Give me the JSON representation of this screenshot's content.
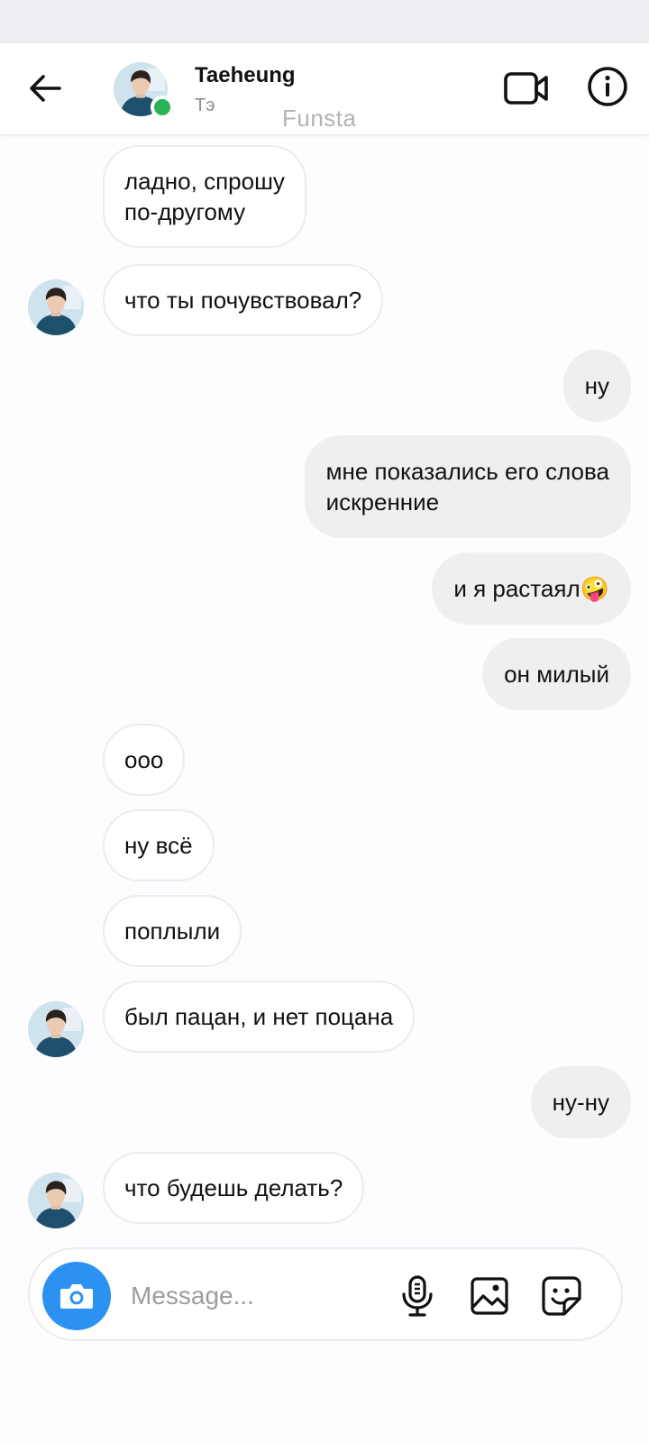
{
  "header": {
    "name": "Taeheung",
    "subtitle": "Тэ",
    "watermark": "Funsta"
  },
  "icons": {
    "back": "arrow-left-icon",
    "video": "video-camera-icon",
    "info": "info-icon",
    "camera": "camera-icon",
    "mic": "microphone-icon",
    "gallery": "image-icon",
    "sticker": "sticker-icon"
  },
  "colors": {
    "accent": "#2c92f2",
    "online": "#29b257",
    "incoming_bubble": "#ffffff",
    "outgoing_bubble": "#efeef1"
  },
  "messages": [
    {
      "from": "them",
      "text": "ладно, спрошу\nпо-другому",
      "avatar": false
    },
    {
      "from": "them",
      "text": "что ты почувствовал?",
      "avatar": true
    },
    {
      "from": "me",
      "text": "ну"
    },
    {
      "from": "me",
      "text": "мне показались его слова\nискренние"
    },
    {
      "from": "me",
      "text": "и я растаял🤪"
    },
    {
      "from": "me",
      "text": "он милый"
    },
    {
      "from": "them",
      "text": "ооо",
      "avatar": false
    },
    {
      "from": "them",
      "text": "ну всё",
      "avatar": false
    },
    {
      "from": "them",
      "text": "поплыли",
      "avatar": false
    },
    {
      "from": "them",
      "text": "был пацан, и нет поцана",
      "avatar": true
    },
    {
      "from": "me",
      "text": "ну-ну"
    },
    {
      "from": "them",
      "text": "что будешь делать?",
      "avatar": true
    }
  ],
  "composer": {
    "placeholder": "Message...",
    "value": ""
  }
}
